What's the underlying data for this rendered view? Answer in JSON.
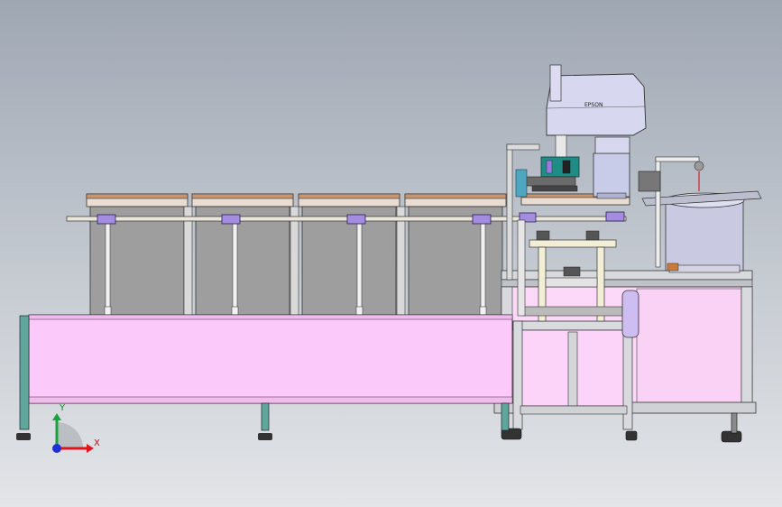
{
  "viewport": {
    "background_top": "#9fa7b3",
    "background_bottom": "#e3e5e8"
  },
  "robot": {
    "brand_label": "EPSON"
  },
  "triad": {
    "x_label": "X",
    "y_label": "Y",
    "x_color": "#e0161b",
    "y_color": "#1aa33c",
    "z_color": "#1d2fd6"
  },
  "colors": {
    "conveyor_pink": "#fcc9fb",
    "purple_bracket": "#a48de0",
    "frame_grey": "#bfc2c6",
    "tray_top": "#c9956f",
    "bin_grey": "#9e9e9e",
    "teal_leg": "#5fa79a",
    "robot_lavender": "#d8d7f0",
    "vibratory_bowl": "#c9c9e2"
  }
}
